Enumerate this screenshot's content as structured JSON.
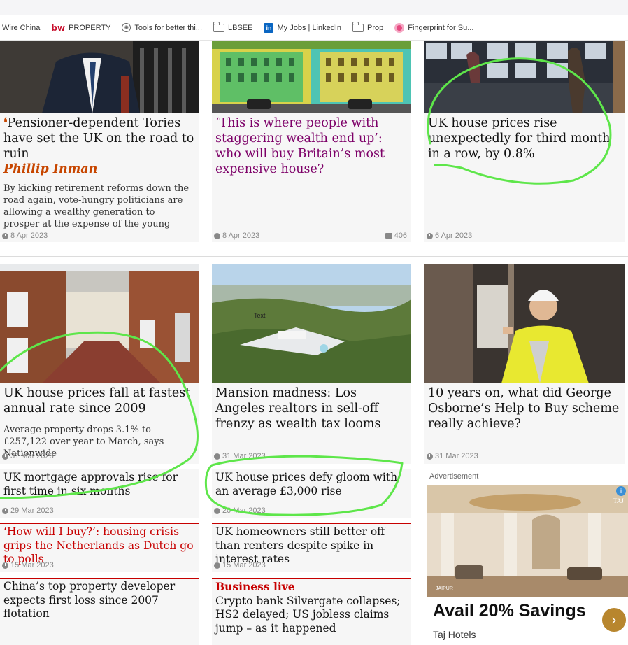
{
  "bookmarks": [
    {
      "label": "Wire China",
      "icon": "none"
    },
    {
      "label": "PROPERTY",
      "icon": "bw-logo-icon",
      "glyph": "bw"
    },
    {
      "label": "Tools for better thi...",
      "icon": "globe-icon",
      "glyph": "✺"
    },
    {
      "label": "LBSEE",
      "icon": "folder-icon"
    },
    {
      "label": "My Jobs | LinkedIn",
      "icon": "linkedin-icon",
      "glyph": "in"
    },
    {
      "label": "Prop",
      "icon": "folder-icon"
    },
    {
      "label": "Fingerprint for Su...",
      "icon": "fingerprint-icon"
    }
  ],
  "row1": {
    "c1": {
      "quote": "❛",
      "headline": "Pensioner-dependent Tories have set the UK on the road to ruin",
      "byline": "Phillip Inman",
      "standfirst": "By kicking retirement reforms down the road again, vote-hungry politicians are allowing a wealthy generation to prosper at the expense of the young",
      "date": "8 Apr 2023"
    },
    "c2": {
      "headline": "‘This is where people with staggering wealth end up’: who will buy Britain’s most expensive house?",
      "date": "8 Apr 2023",
      "comments": "406"
    },
    "c3": {
      "headline": "UK house prices rise unexpectedly for third month in a row, by 0.8%",
      "date": "6 Apr 2023"
    }
  },
  "row2": {
    "c1": {
      "headline": "UK house prices fall at fastest annual rate since 2009",
      "standfirst": "Average property drops 3.1% to £257,122 over year to March, says Nationwide",
      "date": "31 Mar 2023"
    },
    "c2": {
      "headline": "Mansion madness: Los Angeles realtors in sell-off frenzy as wealth tax looms",
      "date": "31 Mar 2023",
      "image_text": "Text"
    },
    "c3": {
      "headline": "10 years on, what did George Osborne’s Help to Buy scheme really achieve?",
      "date": "31 Mar 2023"
    }
  },
  "small": {
    "a1": {
      "headline": "UK mortgage approvals rise for first time in six months",
      "date": "29 Mar 2023"
    },
    "a2": {
      "headline": "UK house prices defy gloom with an average £3,000 rise",
      "date": "20 Mar 2023"
    },
    "b1": {
      "headline": "‘How will I buy?’: housing crisis grips the Netherlands as Dutch go to polls",
      "date": "15 Mar 2023"
    },
    "b2": {
      "headline": "UK homeowners still better off than renters despite spike in interest rates",
      "date": "15 Mar 2023"
    },
    "c1": {
      "headline": "China’s top property developer expects first loss since 2007 flotation"
    },
    "c2": {
      "kicker": "Business live",
      "headline": "Crypto bank Silvergate collapses; HS2 delayed; US jobless claims jump – as it happened"
    }
  },
  "ad": {
    "label": "Advertisement",
    "title": "Avail 20% Savings",
    "brand": "Taj Hotels",
    "location": "JAIPUR",
    "logo": "TAJ",
    "info_glyph": "i",
    "next_glyph": "›"
  },
  "colors": {
    "accent_red": "#c70000",
    "opinion_orange": "#c74600",
    "lifestyle_purple": "#7d0068",
    "annotation_green": "#5ee64a"
  }
}
